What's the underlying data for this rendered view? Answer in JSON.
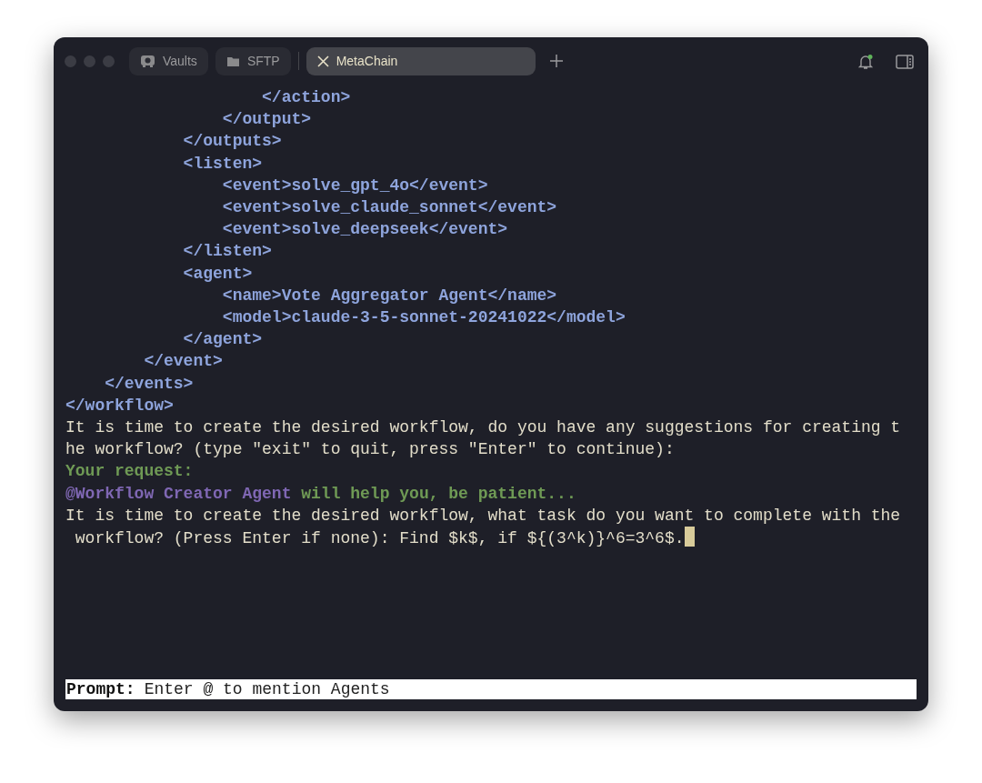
{
  "tabs": [
    {
      "label": "Vaults",
      "kind": "vault",
      "selected": false
    },
    {
      "label": "SFTP",
      "kind": "folder",
      "selected": false
    },
    {
      "label": "MetaChain",
      "kind": "session",
      "selected": true
    }
  ],
  "notifications": {
    "unread": true
  },
  "terminal": {
    "lines": [
      {
        "segments": [
          {
            "kind": "xml",
            "text": "                    </action>"
          }
        ]
      },
      {
        "segments": [
          {
            "kind": "xml",
            "text": "                </output>"
          }
        ]
      },
      {
        "segments": [
          {
            "kind": "xml",
            "text": "            </outputs>"
          }
        ]
      },
      {
        "segments": [
          {
            "kind": "xml",
            "text": "            <listen>"
          }
        ]
      },
      {
        "segments": [
          {
            "kind": "xml",
            "text": "                <event>solve_gpt_4o</event>"
          }
        ]
      },
      {
        "segments": [
          {
            "kind": "xml",
            "text": "                <event>solve_claude_sonnet</event>"
          }
        ]
      },
      {
        "segments": [
          {
            "kind": "xml",
            "text": "                <event>solve_deepseek</event>"
          }
        ]
      },
      {
        "segments": [
          {
            "kind": "xml",
            "text": "            </listen>"
          }
        ]
      },
      {
        "segments": [
          {
            "kind": "xml",
            "text": "            <agent>"
          }
        ]
      },
      {
        "segments": [
          {
            "kind": "xml",
            "text": "                <name>Vote Aggregator Agent</name>"
          }
        ]
      },
      {
        "segments": [
          {
            "kind": "xml",
            "text": "                <model>claude-3-5-sonnet-20241022</model>"
          }
        ]
      },
      {
        "segments": [
          {
            "kind": "xml",
            "text": "            </agent>"
          }
        ]
      },
      {
        "segments": [
          {
            "kind": "xml",
            "text": "        </event>"
          }
        ]
      },
      {
        "segments": [
          {
            "kind": "xml",
            "text": "    </events>"
          }
        ]
      },
      {
        "segments": [
          {
            "kind": "xml",
            "text": "</workflow>"
          }
        ]
      },
      {
        "segments": [
          {
            "kind": "plain",
            "text": "It is time to create the desired workflow, do you have any suggestions for creating t"
          }
        ]
      },
      {
        "segments": [
          {
            "kind": "plain",
            "text": "he workflow? (type \"exit\" to quit, press \"Enter\" to continue):"
          }
        ]
      },
      {
        "segments": [
          {
            "kind": "success",
            "text": "Your request:"
          }
        ]
      },
      {
        "segments": [
          {
            "kind": "agent",
            "text": "@Workflow Creator Agent"
          },
          {
            "kind": "success",
            "text": " will help you, be patient..."
          }
        ]
      },
      {
        "segments": [
          {
            "kind": "plain",
            "text": "It is time to create the desired workflow, what task do you want to complete with the"
          }
        ]
      },
      {
        "segments": [
          {
            "kind": "plain",
            "text": " workflow? (Press Enter if none): Find $k$, if ${(3^k)}^6=3^6$."
          }
        ],
        "cursor": true
      }
    ]
  },
  "prompt": {
    "label": "Prompt:",
    "placeholder": "Enter @ to mention Agents"
  }
}
